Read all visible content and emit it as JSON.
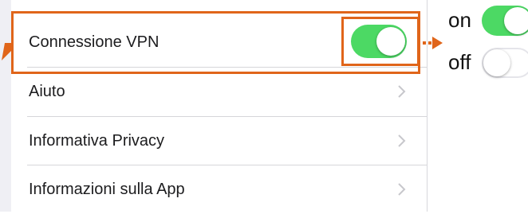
{
  "settings": {
    "items": [
      {
        "label": "Connessione VPN",
        "kind": "toggle",
        "on": true
      },
      {
        "label": "Aiuto",
        "kind": "chevron"
      },
      {
        "label": "Informativa Privacy",
        "kind": "chevron"
      },
      {
        "label": "Informazioni sulla App",
        "kind": "chevron"
      }
    ]
  },
  "legend": {
    "on_label": "on",
    "off_label": "off"
  },
  "colors": {
    "toggle_on": "#4cd964",
    "highlight": "#e0651a",
    "chevron": "#c7c7cc"
  },
  "icons": {
    "chevron": "chevron-right-icon"
  }
}
